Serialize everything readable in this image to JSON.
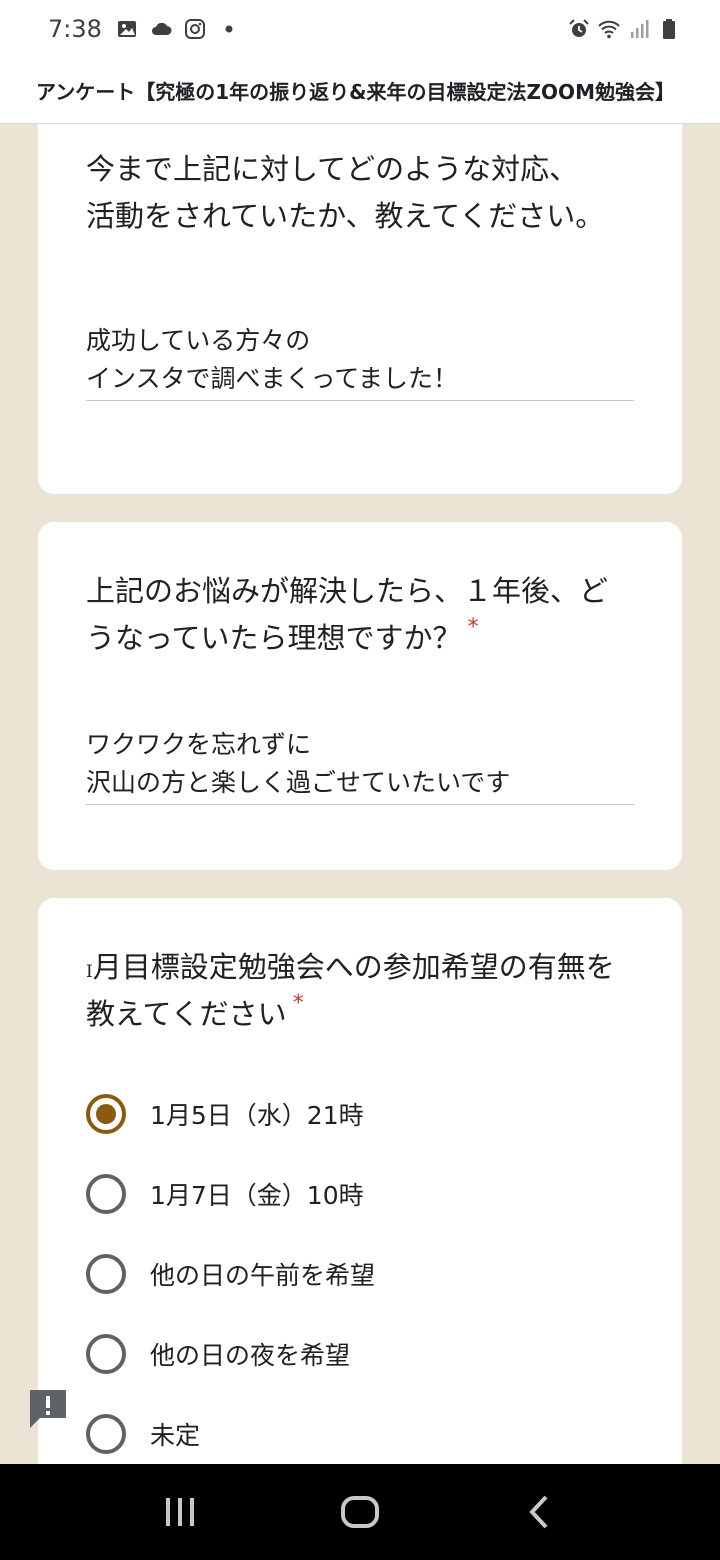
{
  "status": {
    "time": "7:38"
  },
  "header": {
    "title": "アンケート【究極の1年の振り返り&来年の目標設定法ZOOM勉強会】"
  },
  "questions": [
    {
      "title": "今まで上記に対してどのような対応、活動をされていたか、教えてください。",
      "answer": "成功している方々の\nインスタで調べまくってました！"
    },
    {
      "title": "上記のお悩みが解決したら、１年後、どうなっていたら理想ですか？",
      "required_mark": "*",
      "answer": "ワクワクを忘れずに\n沢山の方と楽しく過ごせていたいです"
    },
    {
      "title_prefix": "I",
      "title": "月目標設定勉強会への参加希望の有無を教えてください",
      "required_mark": "*",
      "options": [
        {
          "label": "1月5日（水）21時",
          "selected": true
        },
        {
          "label": "1月7日（金）10時",
          "selected": false
        },
        {
          "label": "他の日の午前を希望",
          "selected": false
        },
        {
          "label": "他の日の夜を希望",
          "selected": false
        },
        {
          "label": "未定",
          "selected": false
        }
      ]
    }
  ],
  "colors": {
    "background": "#ebe3d3",
    "accent": "#8a5a0f",
    "required": "#d93025"
  },
  "icons": {
    "status_left": [
      "image-icon",
      "cloud-icon",
      "instagram-icon",
      "dot-icon"
    ],
    "status_right": [
      "alarm-icon",
      "wifi-icon",
      "signal-icon",
      "battery-icon"
    ],
    "nav": [
      "recents-icon",
      "home-icon",
      "back-icon"
    ],
    "feedback": "report-feedback-icon"
  }
}
